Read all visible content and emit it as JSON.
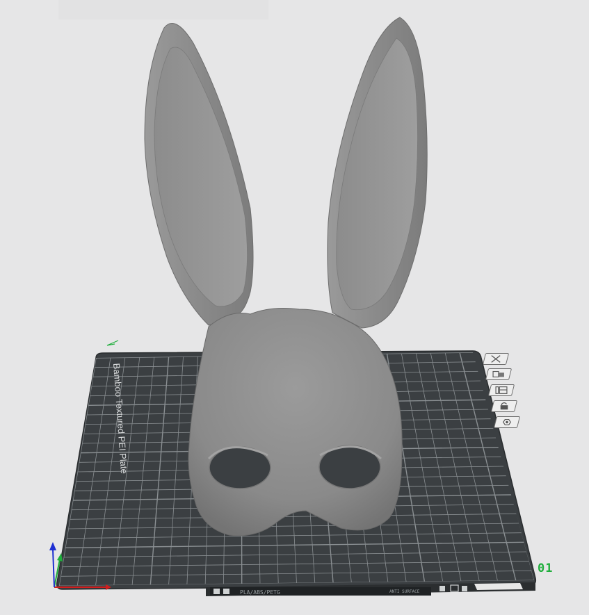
{
  "plate": {
    "name": "Bamboo Textured PEI Plate",
    "number": "01",
    "filament_label": "PLA/ABS/PETG",
    "surface_label": "ANTI SURFACE"
  },
  "colors": {
    "background": "#e6e6e7",
    "plate_surface": "#3b3f42",
    "grid_line": "#8a8f92",
    "model": "#8c8c8c",
    "plate_number": "#1fae3c",
    "axis_x": "#d21e1e",
    "axis_y": "#1fae3c",
    "axis_z": "#1e2fd2"
  },
  "plate_tools": [
    {
      "name": "remove-plate-icon",
      "label": "Remove plate"
    },
    {
      "name": "arrange-icon",
      "label": "Arrange"
    },
    {
      "name": "orient-icon",
      "label": "Auto orient"
    },
    {
      "name": "lock-icon",
      "label": "Lock plate"
    },
    {
      "name": "settings-icon",
      "label": "Plate settings"
    }
  ]
}
